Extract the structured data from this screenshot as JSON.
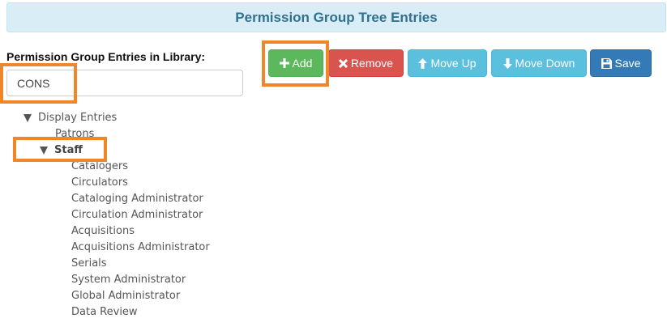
{
  "header": {
    "title": "Permission Group Tree Entries"
  },
  "library": {
    "label": "Permission Group Entries in Library:",
    "value": "CONS"
  },
  "toolbar": {
    "add_label": "Add",
    "remove_label": "Remove",
    "move_up_label": "Move Up",
    "move_down_label": "Move Down",
    "save_label": "Save"
  },
  "tree": {
    "root": "Display Entries",
    "patrons": "Patrons",
    "staff": "Staff",
    "staff_children": [
      "Catalogers",
      "Circulators",
      "Cataloging Administrator",
      "Circulation Administrator",
      "Acquisitions",
      "Acquisitions Administrator",
      "Serials",
      "System Administrator",
      "Global Administrator",
      "Data Review"
    ]
  },
  "colors": {
    "highlight": "#f0862a",
    "header_bg": "#d9edf7",
    "header_text": "#31708f",
    "add": "#5cb85c",
    "remove": "#d9534f",
    "move": "#5bc0de",
    "save": "#337ab7"
  },
  "icons": {
    "add": "plus-icon",
    "remove": "times-icon",
    "move_up": "arrow-up-icon",
    "move_down": "arrow-down-icon",
    "save": "floppy-disk-icon",
    "expanded": "triangle-down-icon"
  }
}
